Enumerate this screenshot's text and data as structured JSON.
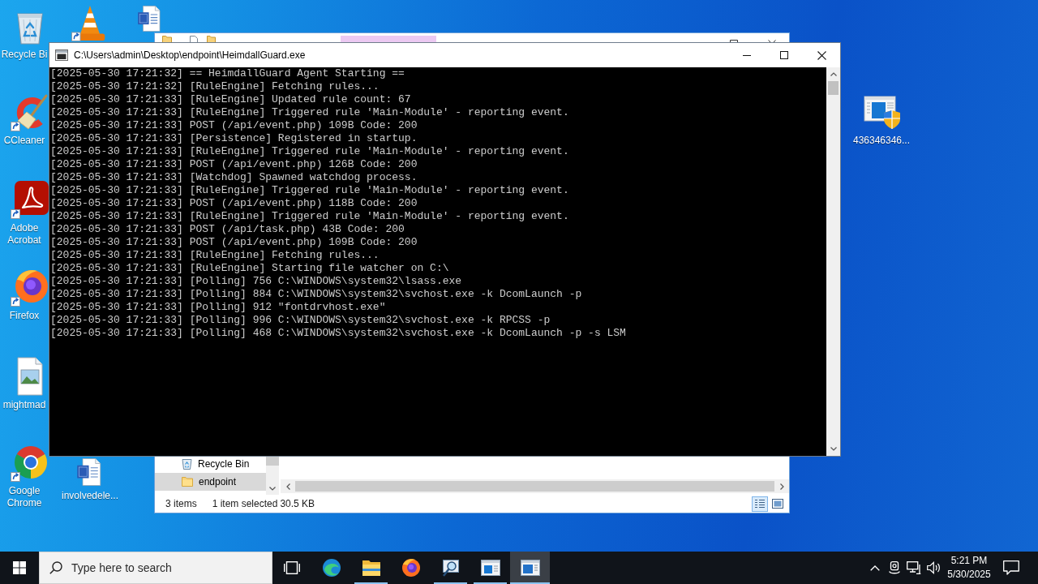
{
  "desktop": {
    "icons": [
      {
        "kind": "bin",
        "label": "Recycle Bi"
      },
      {
        "kind": "cone"
      },
      {
        "kind": "doc"
      },
      {
        "kind": "broom",
        "label": "CCleaner"
      },
      {
        "kind": "pdf",
        "label": "Adobe Acrobat"
      },
      {
        "kind": "fox",
        "label": "Firefox"
      },
      {
        "kind": "picture",
        "label": "mightmad"
      },
      {
        "kind": "wheel",
        "label": "Google Chrome"
      },
      {
        "kind": "doc",
        "label": "involvedele..."
      },
      {
        "kind": "setup",
        "label": "436346346..."
      }
    ]
  },
  "explorer": {
    "nav_items": [
      {
        "kind": "bin",
        "label": "Recycle Bin",
        "selected": false
      },
      {
        "kind": "folder",
        "label": "endpoint",
        "selected": true
      }
    ],
    "status": {
      "items": "3 items",
      "selection": "1 item selected",
      "size": "30.5 KB"
    },
    "views": [
      {
        "kind": "details",
        "selected": true
      },
      {
        "kind": "thumbnails",
        "selected": false
      }
    ]
  },
  "console": {
    "title": "C:\\Users\\admin\\Desktop\\endpoint\\HeimdallGuard.exe",
    "lines": [
      "[2025-05-30 17:21:32] == HeimdallGuard Agent Starting ==",
      "[2025-05-30 17:21:32] [RuleEngine] Fetching rules...",
      "[2025-05-30 17:21:33] [RuleEngine] Updated rule count: 67",
      "[2025-05-30 17:21:33] [RuleEngine] Triggered rule 'Main-Module' - reporting event.",
      "[2025-05-30 17:21:33] POST (/api/event.php) 109B Code: 200",
      "[2025-05-30 17:21:33] [Persistence] Registered in startup.",
      "[2025-05-30 17:21:33] [RuleEngine] Triggered rule 'Main-Module' - reporting event.",
      "[2025-05-30 17:21:33] POST (/api/event.php) 126B Code: 200",
      "[2025-05-30 17:21:33] [Watchdog] Spawned watchdog process.",
      "[2025-05-30 17:21:33] [RuleEngine] Triggered rule 'Main-Module' - reporting event.",
      "[2025-05-30 17:21:33] POST (/api/event.php) 118B Code: 200",
      "[2025-05-30 17:21:33] [RuleEngine] Triggered rule 'Main-Module' - reporting event.",
      "[2025-05-30 17:21:33] POST (/api/task.php) 43B Code: 200",
      "[2025-05-30 17:21:33] POST (/api/event.php) 109B Code: 200",
      "[2025-05-30 17:21:33] [RuleEngine] Fetching rules...",
      "[2025-05-30 17:21:33] [RuleEngine] Starting file watcher on C:\\",
      "[2025-05-30 17:21:33] [Polling] 756 C:\\WINDOWS\\system32\\lsass.exe",
      "[2025-05-30 17:21:33] [Polling] 884 C:\\WINDOWS\\system32\\svchost.exe -k DcomLaunch -p",
      "[2025-05-30 17:21:33] [Polling] 912 \"fontdrvhost.exe\"",
      "[2025-05-30 17:21:33] [Polling] 996 C:\\WINDOWS\\system32\\svchost.exe -k RPCSS -p",
      "[2025-05-30 17:21:33] [Polling] 468 C:\\WINDOWS\\system32\\svchost.exe -k DcomLaunch -p -s LSM"
    ]
  },
  "taskbar": {
    "search": {
      "placeholder": "Type here to search"
    },
    "apps": [
      {
        "kind": "wave",
        "running": false,
        "selected": false
      },
      {
        "kind": "folder",
        "running": true,
        "selected": false
      },
      {
        "kind": "fox",
        "running": false,
        "selected": false
      },
      {
        "kind": "magnifier",
        "running": true,
        "selected": false
      },
      {
        "kind": "window",
        "running": true,
        "selected": false
      },
      {
        "kind": "console",
        "running": true,
        "selected": true
      }
    ],
    "clock": {
      "time": "5:21 PM",
      "date": "5/30/2025"
    }
  }
}
